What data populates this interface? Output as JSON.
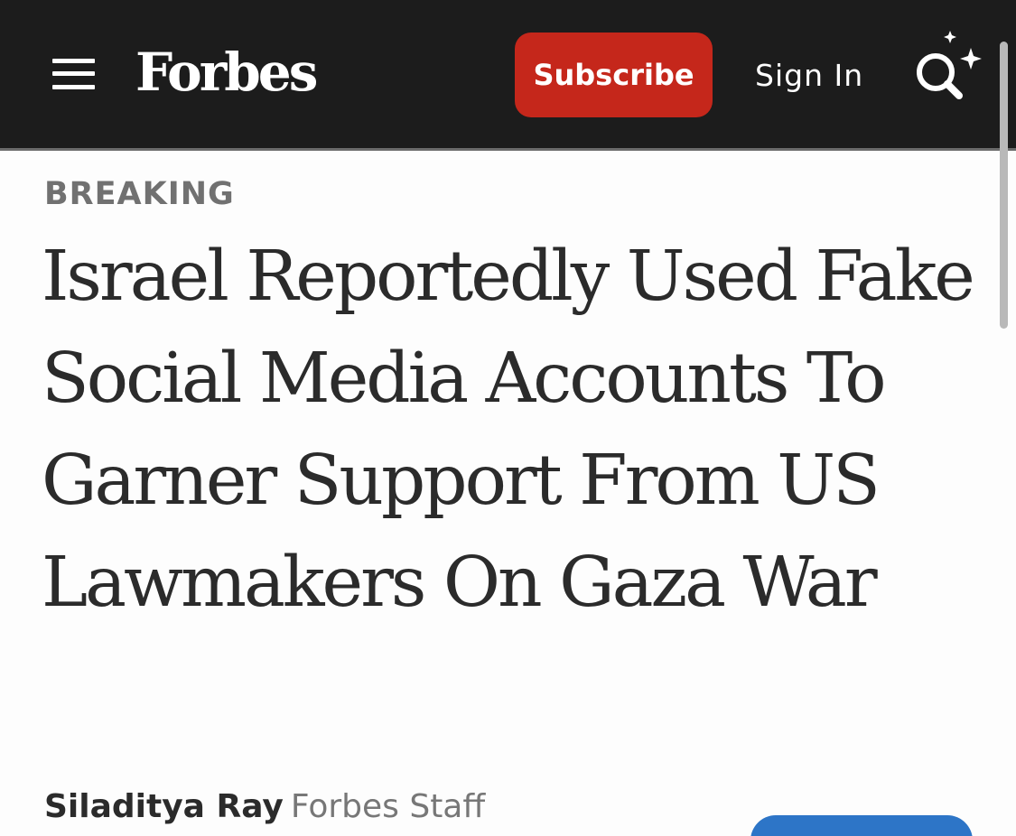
{
  "header": {
    "logo": "Forbes",
    "subscribe_label": "Subscribe",
    "signin_label": "Sign In",
    "menu_icon": "hamburger-menu-icon",
    "search_icon": "search-sparkle-icon"
  },
  "article": {
    "kicker": "BREAKING",
    "headline": "Israel Reportedly Used Fake Social Media Accounts To Garner Support From US Lawmakers On Gaza War",
    "author": "Siladitya Ray",
    "author_role": "Forbes Staff"
  },
  "colors": {
    "header_bg": "#1c1c1c",
    "subscribe_bg": "#c5271b",
    "page_bg": "#fdfdfd",
    "headline_text": "#2b2b2b",
    "kicker_text": "#717171",
    "follow_button": "#2d75c7"
  }
}
